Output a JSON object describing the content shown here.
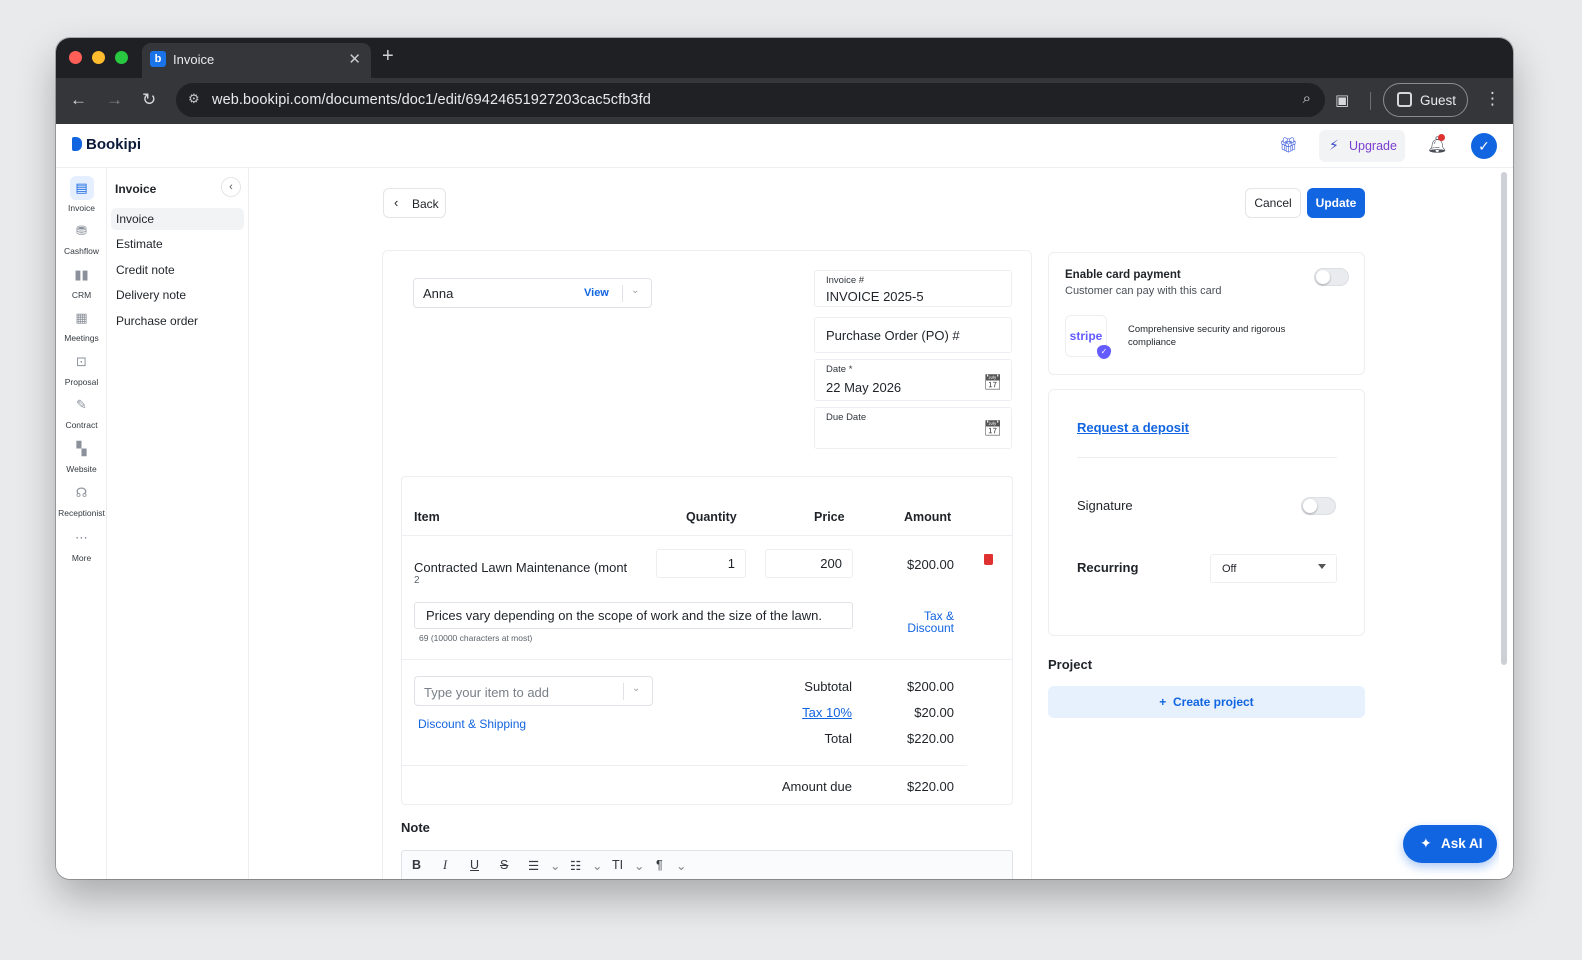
{
  "browser": {
    "tab_title": "Invoice",
    "tab_favicon_letter": "b",
    "url": "web.bookipi.com/documents/doc1/edit/69424651927203cac5cfb3fd",
    "profile_label": "Guest"
  },
  "header": {
    "brand": "Bookipi",
    "upgrade_label": "Upgrade",
    "avatar_glyph": "✓"
  },
  "rail": [
    {
      "label": "Invoice",
      "icon": "document-icon"
    },
    {
      "label": "Cashflow",
      "icon": "coins-icon"
    },
    {
      "label": "CRM",
      "icon": "chart-bars-icon"
    },
    {
      "label": "Meetings",
      "icon": "calendar-icon"
    },
    {
      "label": "Proposal",
      "icon": "presentation-icon"
    },
    {
      "label": "Contract",
      "icon": "pen-icon"
    },
    {
      "label": "Website",
      "icon": "layout-icon"
    },
    {
      "label": "Receptionist",
      "icon": "headset-icon"
    },
    {
      "label": "More",
      "icon": "more-icon"
    }
  ],
  "subnav": {
    "title": "Invoice",
    "items": [
      "Invoice",
      "Estimate",
      "Credit note",
      "Delivery note",
      "Purchase order"
    ]
  },
  "actions": {
    "back": "Back",
    "cancel": "Cancel",
    "update": "Update"
  },
  "doc": {
    "client": {
      "name": "Anna",
      "view_label": "View"
    },
    "invoice_no": {
      "label": "Invoice #",
      "value": "INVOICE 2025-5"
    },
    "po_placeholder": "Purchase Order (PO) #",
    "date": {
      "label": "Date *",
      "value": "22 May 2026"
    },
    "due_date": {
      "label": "Due Date",
      "value": ""
    }
  },
  "items": {
    "headers": {
      "item": "Item",
      "quantity": "Quantity",
      "price": "Price",
      "amount": "Amount"
    },
    "rows": [
      {
        "description": "Contracted Lawn Maintenance (mont",
        "sub": "2",
        "quantity": "1",
        "price": "200",
        "amount": "$200.00",
        "note": "Prices vary depending on the scope of work and the size of the lawn.",
        "note_counter": "69 (10000 characters at most)",
        "tax_discount_label": "Tax & Discount"
      }
    ],
    "add_placeholder": "Type your item to add",
    "discount_shipping_label": "Discount & Shipping"
  },
  "totals": {
    "subtotal_label": "Subtotal",
    "subtotal": "$200.00",
    "tax_label": "Tax 10%",
    "tax": "$20.00",
    "total_label": "Total",
    "total": "$220.00",
    "amount_due_label": "Amount due",
    "amount_due": "$220.00"
  },
  "note": {
    "heading": "Note",
    "toolbar": [
      "B",
      "I",
      "U",
      "S",
      "☰",
      "⌄",
      "☷",
      "⌄",
      "TI",
      "⌄",
      "¶",
      "⌄"
    ]
  },
  "payment": {
    "title": "Enable card payment",
    "subtitle": "Customer can pay with this card",
    "enabled": false,
    "stripe_logo": "stripe",
    "stripe_text": "Comprehensive security and rigorous compliance"
  },
  "options": {
    "deposit_link": "Request a deposit",
    "signature_label": "Signature",
    "signature_enabled": false,
    "recurring_label": "Recurring",
    "recurring_value": "Off"
  },
  "project": {
    "heading": "Project",
    "create_label": "Create project"
  },
  "ask_ai_label": "Ask AI",
  "colors": {
    "accent": "#1265e0",
    "danger": "#e03131",
    "upgrade": "#7b3fcf"
  }
}
